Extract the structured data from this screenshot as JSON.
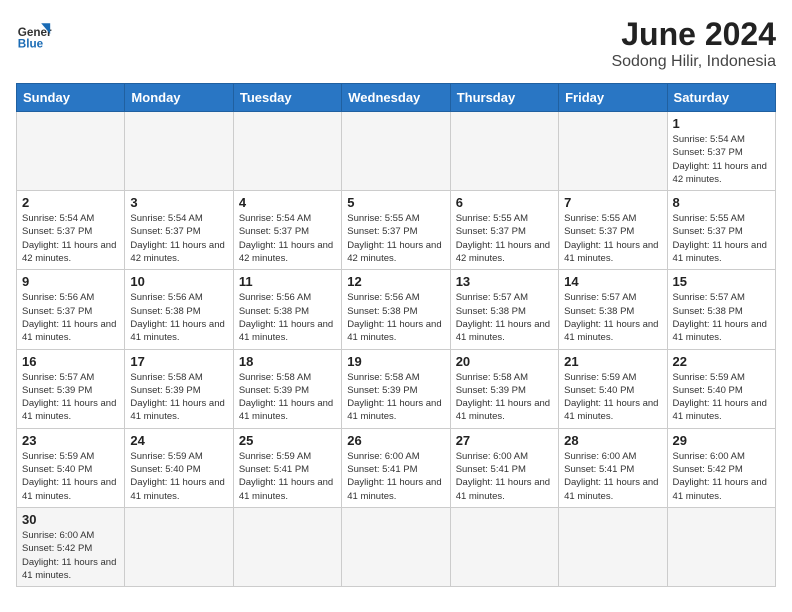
{
  "logo": {
    "text_general": "General",
    "text_blue": "Blue"
  },
  "title": {
    "month_year": "June 2024",
    "location": "Sodong Hilir, Indonesia"
  },
  "days_of_week": [
    "Sunday",
    "Monday",
    "Tuesday",
    "Wednesday",
    "Thursday",
    "Friday",
    "Saturday"
  ],
  "weeks": [
    [
      {
        "day": null,
        "empty": true
      },
      {
        "day": null,
        "empty": true
      },
      {
        "day": null,
        "empty": true
      },
      {
        "day": null,
        "empty": true
      },
      {
        "day": null,
        "empty": true
      },
      {
        "day": null,
        "empty": true
      },
      {
        "day": 1,
        "sunrise": "5:54 AM",
        "sunset": "5:37 PM",
        "daylight": "11 hours and 42 minutes."
      }
    ],
    [
      {
        "day": 2,
        "sunrise": "5:54 AM",
        "sunset": "5:37 PM",
        "daylight": "11 hours and 42 minutes."
      },
      {
        "day": 3,
        "sunrise": "5:54 AM",
        "sunset": "5:37 PM",
        "daylight": "11 hours and 42 minutes."
      },
      {
        "day": 4,
        "sunrise": "5:54 AM",
        "sunset": "5:37 PM",
        "daylight": "11 hours and 42 minutes."
      },
      {
        "day": 5,
        "sunrise": "5:55 AM",
        "sunset": "5:37 PM",
        "daylight": "11 hours and 42 minutes."
      },
      {
        "day": 6,
        "sunrise": "5:55 AM",
        "sunset": "5:37 PM",
        "daylight": "11 hours and 42 minutes."
      },
      {
        "day": 7,
        "sunrise": "5:55 AM",
        "sunset": "5:37 PM",
        "daylight": "11 hours and 41 minutes."
      },
      {
        "day": 8,
        "sunrise": "5:55 AM",
        "sunset": "5:37 PM",
        "daylight": "11 hours and 41 minutes."
      }
    ],
    [
      {
        "day": 9,
        "sunrise": "5:56 AM",
        "sunset": "5:37 PM",
        "daylight": "11 hours and 41 minutes."
      },
      {
        "day": 10,
        "sunrise": "5:56 AM",
        "sunset": "5:38 PM",
        "daylight": "11 hours and 41 minutes."
      },
      {
        "day": 11,
        "sunrise": "5:56 AM",
        "sunset": "5:38 PM",
        "daylight": "11 hours and 41 minutes."
      },
      {
        "day": 12,
        "sunrise": "5:56 AM",
        "sunset": "5:38 PM",
        "daylight": "11 hours and 41 minutes."
      },
      {
        "day": 13,
        "sunrise": "5:57 AM",
        "sunset": "5:38 PM",
        "daylight": "11 hours and 41 minutes."
      },
      {
        "day": 14,
        "sunrise": "5:57 AM",
        "sunset": "5:38 PM",
        "daylight": "11 hours and 41 minutes."
      },
      {
        "day": 15,
        "sunrise": "5:57 AM",
        "sunset": "5:38 PM",
        "daylight": "11 hours and 41 minutes."
      }
    ],
    [
      {
        "day": 16,
        "sunrise": "5:57 AM",
        "sunset": "5:39 PM",
        "daylight": "11 hours and 41 minutes."
      },
      {
        "day": 17,
        "sunrise": "5:58 AM",
        "sunset": "5:39 PM",
        "daylight": "11 hours and 41 minutes."
      },
      {
        "day": 18,
        "sunrise": "5:58 AM",
        "sunset": "5:39 PM",
        "daylight": "11 hours and 41 minutes."
      },
      {
        "day": 19,
        "sunrise": "5:58 AM",
        "sunset": "5:39 PM",
        "daylight": "11 hours and 41 minutes."
      },
      {
        "day": 20,
        "sunrise": "5:58 AM",
        "sunset": "5:39 PM",
        "daylight": "11 hours and 41 minutes."
      },
      {
        "day": 21,
        "sunrise": "5:59 AM",
        "sunset": "5:40 PM",
        "daylight": "11 hours and 41 minutes."
      },
      {
        "day": 22,
        "sunrise": "5:59 AM",
        "sunset": "5:40 PM",
        "daylight": "11 hours and 41 minutes."
      }
    ],
    [
      {
        "day": 23,
        "sunrise": "5:59 AM",
        "sunset": "5:40 PM",
        "daylight": "11 hours and 41 minutes."
      },
      {
        "day": 24,
        "sunrise": "5:59 AM",
        "sunset": "5:40 PM",
        "daylight": "11 hours and 41 minutes."
      },
      {
        "day": 25,
        "sunrise": "5:59 AM",
        "sunset": "5:41 PM",
        "daylight": "11 hours and 41 minutes."
      },
      {
        "day": 26,
        "sunrise": "6:00 AM",
        "sunset": "5:41 PM",
        "daylight": "11 hours and 41 minutes."
      },
      {
        "day": 27,
        "sunrise": "6:00 AM",
        "sunset": "5:41 PM",
        "daylight": "11 hours and 41 minutes."
      },
      {
        "day": 28,
        "sunrise": "6:00 AM",
        "sunset": "5:41 PM",
        "daylight": "11 hours and 41 minutes."
      },
      {
        "day": 29,
        "sunrise": "6:00 AM",
        "sunset": "5:42 PM",
        "daylight": "11 hours and 41 minutes."
      }
    ],
    [
      {
        "day": 30,
        "sunrise": "6:00 AM",
        "sunset": "5:42 PM",
        "daylight": "11 hours and 41 minutes."
      },
      {
        "day": null,
        "empty": true
      },
      {
        "day": null,
        "empty": true
      },
      {
        "day": null,
        "empty": true
      },
      {
        "day": null,
        "empty": true
      },
      {
        "day": null,
        "empty": true
      },
      {
        "day": null,
        "empty": true
      }
    ]
  ]
}
